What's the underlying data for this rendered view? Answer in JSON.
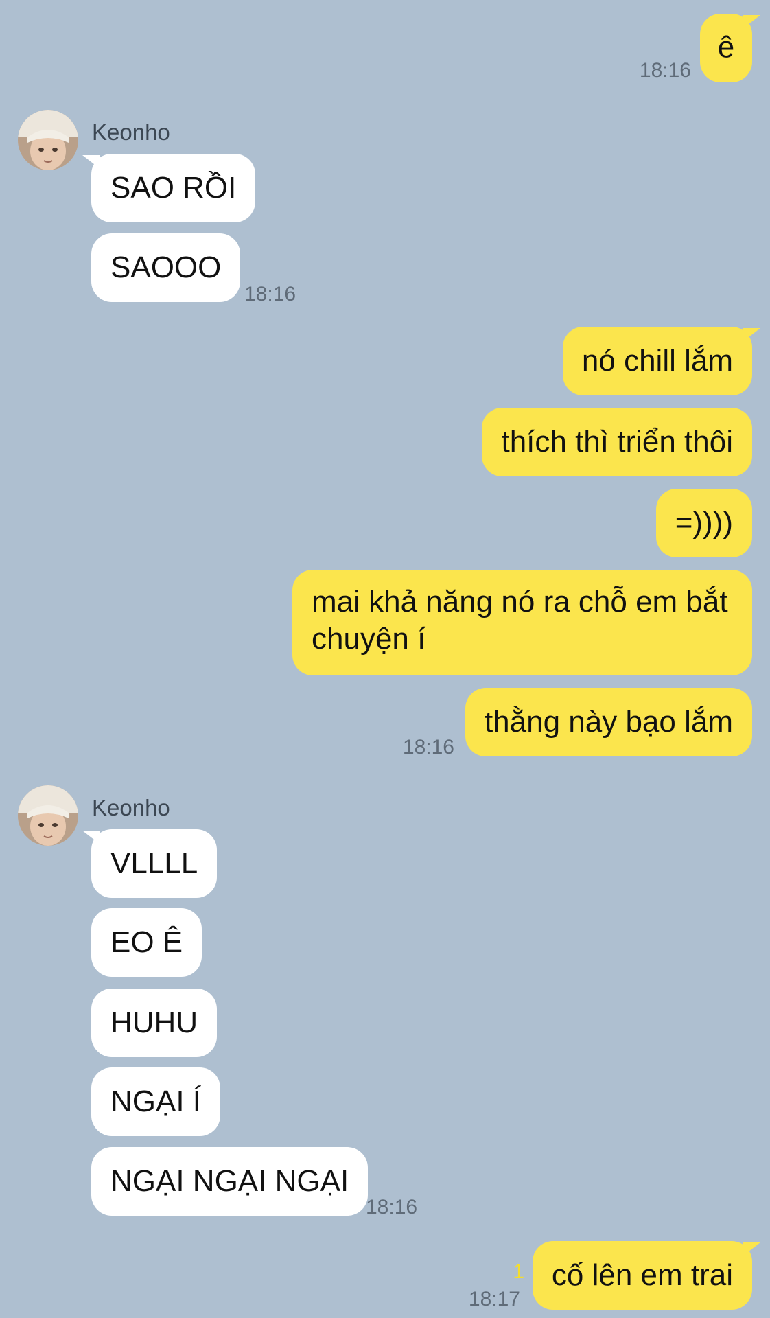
{
  "contact": {
    "name": "Keonho",
    "avatar_icon": "profile-photo-avatar"
  },
  "colors": {
    "background": "#aebfd0",
    "outgoing_bubble": "#fbe54d",
    "incoming_bubble": "#ffffff",
    "timestamp": "#5f6b78",
    "unread_count": "#f4dd2e"
  },
  "messages": {
    "m1": {
      "text": "ê",
      "time": "18:16"
    },
    "m2": {
      "sender": "Keonho",
      "text": "SAO RỒI"
    },
    "m3": {
      "text": "SAOOO",
      "time": "18:16"
    },
    "m4": {
      "text": "nó chill lắm"
    },
    "m5": {
      "text": "thích thì triển thôi"
    },
    "m6": {
      "text": "=))))"
    },
    "m7": {
      "text": "mai khả năng nó ra chỗ em bắt chuyện í"
    },
    "m8": {
      "text": "thằng này bạo lắm",
      "time": "18:16"
    },
    "m9": {
      "sender": "Keonho",
      "text": "VLLLL"
    },
    "m10": {
      "text": "EO Ê"
    },
    "m11": {
      "text": "HUHU"
    },
    "m12": {
      "text": "NGẠI Í"
    },
    "m13": {
      "text": "NGẠI NGẠI NGẠI",
      "time": "18:16"
    },
    "m14": {
      "text": "cố lên em trai",
      "time": "18:17",
      "unread": "1"
    }
  }
}
